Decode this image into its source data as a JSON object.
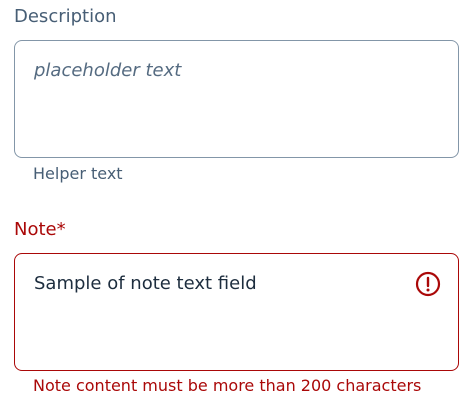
{
  "description": {
    "label": "Description",
    "placeholder": "placeholder text",
    "helper": "Helper text"
  },
  "note": {
    "label": "Note*",
    "value": "Sample of note text field",
    "error_message": "Note content must be more than 200 characters",
    "error_icon": "exclamation-circle-icon"
  },
  "colors": {
    "label": "#475e75",
    "text": "#1d2d3e",
    "placeholder": "#556b81",
    "border": "#8396a8",
    "error": "#aa0808"
  }
}
